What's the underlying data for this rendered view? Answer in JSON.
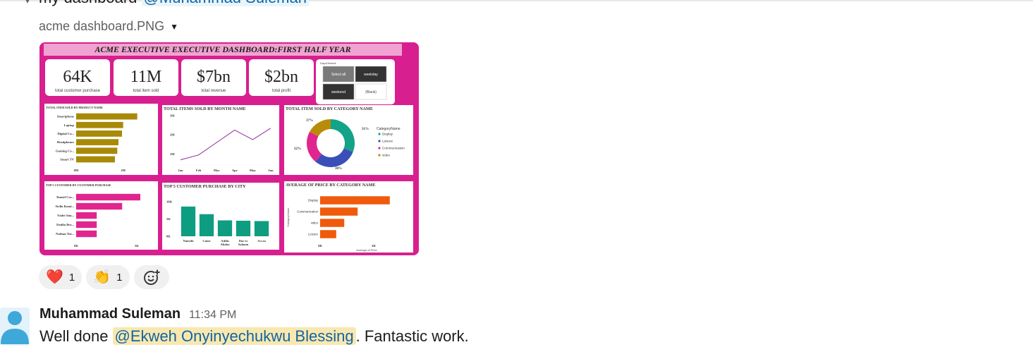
{
  "previous_message": {
    "text": "my dashboard",
    "mention": "@Muhammad Suleman"
  },
  "file": {
    "name": "acme dashboard.PNG"
  },
  "dashboard": {
    "title": "ACME EXECUTIVE EXECUTIVE DASHBOARD:FIRST HALF YEAR",
    "kpis": [
      {
        "value": "64K",
        "label": "total customer purchase"
      },
      {
        "value": "11M",
        "label": "total item sold"
      },
      {
        "value": "$7bn",
        "label": "total revenue"
      },
      {
        "value": "$2bn",
        "label": "total profit"
      }
    ],
    "slicer": {
      "title": "DaysOfweek",
      "options": [
        "Select all",
        "weekday",
        "weekend",
        "(Blank)"
      ]
    },
    "colors": {
      "bg": "#d81f8f",
      "olive": "#a88a08",
      "pink": "#e0268e",
      "teal": "#0f9d82",
      "orange": "#f05a0c",
      "line": "#9b3fa6"
    }
  },
  "chart_data": [
    {
      "type": "bar",
      "title": "TOTAL ITEM SOLD BY PRODUCT NAME",
      "orientation": "horizontal",
      "categories": [
        "Smartphone",
        "Laptop",
        "Digital Ca...",
        "Headphones",
        "Gaming Co...",
        "Smart TV"
      ],
      "values": [
        2.6,
        2.0,
        1.95,
        1.8,
        1.75,
        1.65
      ],
      "xticks": [
        "0M",
        "2M"
      ],
      "xlim": [
        0,
        3
      ]
    },
    {
      "type": "line",
      "title": "TOTAL ITEMS SOLD BY MONTH NAME",
      "categories": [
        "Jan",
        "Feb",
        "Mar",
        "Apr",
        "May",
        "Jun"
      ],
      "values": [
        0.7,
        0.95,
        1.6,
        2.25,
        1.75,
        2.35
      ],
      "yticks": [
        "1M",
        "2M",
        "3M"
      ],
      "ylim": [
        0.5,
        3
      ]
    },
    {
      "type": "pie",
      "title": "TOTAL ITEM SOLD BY CATEGORY NAME",
      "legend_title": "CategoryName",
      "slices": [
        {
          "label": "Display",
          "value": 31,
          "display": "31%",
          "color": "#13a388"
        },
        {
          "label": "Leisure",
          "value": 30,
          "display": "30%",
          "color": "#3a50b8"
        },
        {
          "label": "Communication",
          "value": 22,
          "display": "22%",
          "color": "#e0268e"
        },
        {
          "label": "video",
          "value": 17,
          "display": "17%",
          "color": "#b88c08"
        }
      ]
    },
    {
      "type": "bar",
      "title": "TOP 5 CUSTOMER BY CUSTOMER PURCHASE",
      "orientation": "horizontal",
      "categories": [
        "Daniel Cos...",
        "Stella Kami...",
        "Violet Sim...",
        "Emilia Bro...",
        "Nathan Tur..."
      ],
      "values": [
        5.3,
        3.8,
        1.7,
        1.7,
        1.7
      ],
      "xticks": [
        "0K",
        "5K"
      ],
      "xlim": [
        0,
        6
      ]
    },
    {
      "type": "bar",
      "title": "TOP 5 CUSTOMER PURCHASE BY CITY",
      "categories": [
        "Nairobi",
        "Cairo",
        "Addis Ababa",
        "Dar es Salaam",
        "Accra"
      ],
      "values": [
        8.6,
        6.4,
        4.6,
        4.5,
        4.4
      ],
      "yticks": [
        "0K",
        "5K",
        "10K"
      ],
      "ylim": [
        0,
        10
      ]
    },
    {
      "type": "bar",
      "title": "AVERAGE OF PRICE BY CATEGORY NAME",
      "orientation": "horizontal",
      "categories": [
        "Display",
        "Communication",
        "video",
        "Leisure"
      ],
      "values": [
        1.3,
        0.7,
        0.45,
        0.3
      ],
      "xticks": [
        "0K",
        "1K"
      ],
      "xlim": [
        0,
        1.5
      ],
      "xlabel": "Average of Price",
      "ylabel": "CategoryName"
    }
  ],
  "reactions": [
    {
      "emoji": "❤️",
      "name": "heart",
      "count": "1"
    },
    {
      "emoji": "👏",
      "name": "clap",
      "count": "1"
    }
  ],
  "message": {
    "author": "Muhammad Suleman",
    "time": "11:34 PM",
    "text_before": "Well done ",
    "mention": "@Ekweh Onyinyechukwu Blessing",
    "text_after": ". Fantastic work."
  }
}
